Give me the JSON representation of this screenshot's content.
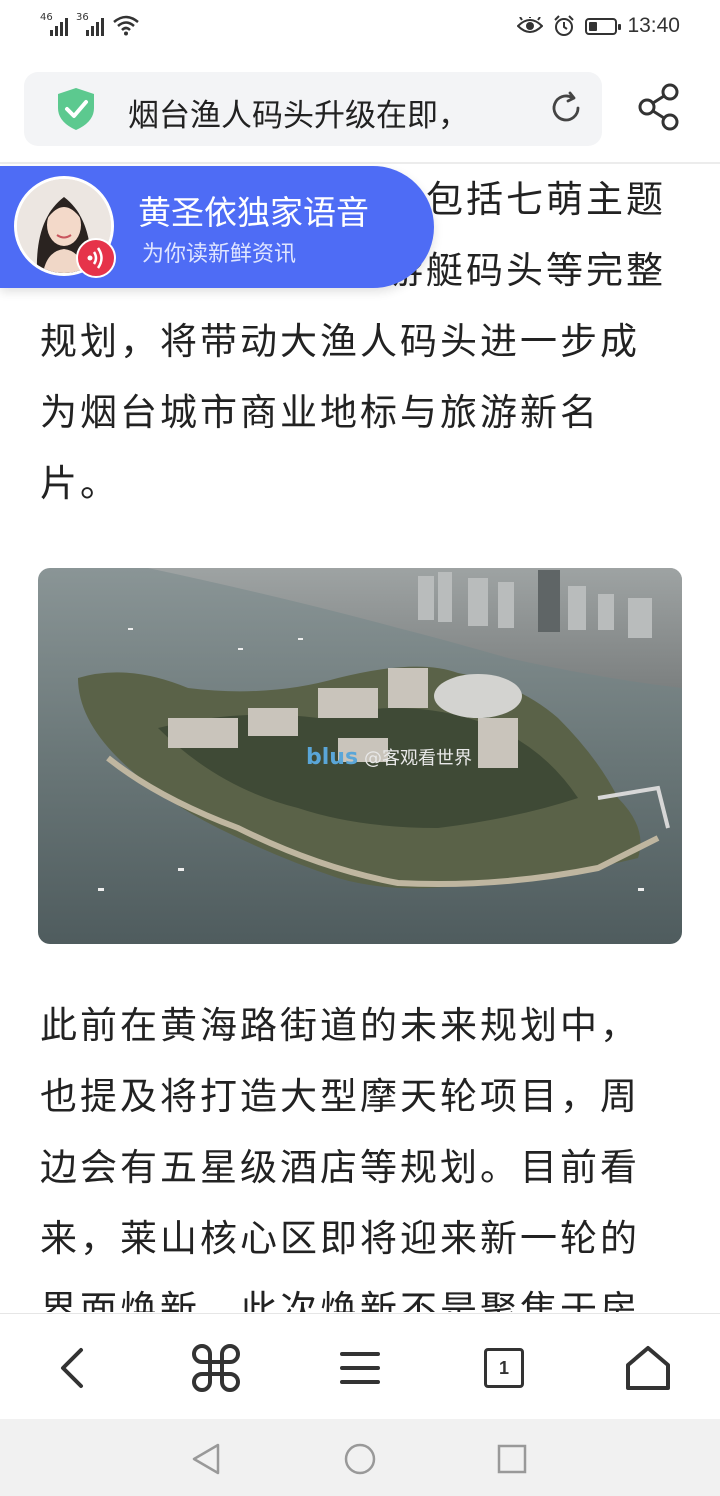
{
  "status_bar": {
    "network_1": "46",
    "network_2": "36",
    "time": "13:40",
    "icons": [
      "signal-icon",
      "signal-icon",
      "wifi-icon",
      "eye-icon",
      "alarm-icon",
      "battery-icon"
    ],
    "battery_level": 0.35
  },
  "address_bar": {
    "security_icon": "shield-check-icon",
    "title": "烟台渔人码头升级在即，",
    "reload_icon": "reload-icon",
    "share_icon": "share-icon",
    "shield_color": "#5cc98f"
  },
  "voice_banner": {
    "title": "黄圣依独家语音",
    "subtitle": "为你读新鲜资讯",
    "background": "#4e6cf5",
    "badge_color": "#e6334a"
  },
  "article": {
    "paragraph_1_lines": [
      "包括七萌主题",
      "游艇码头等完整",
      "规划，将带动大渔人码头进一步成",
      "为烟台城市商业地标与旅游新名",
      "片。"
    ],
    "photo": {
      "watermark_brand": "blus",
      "watermark_text": "@客观看世界"
    },
    "paragraph_2_lines": [
      "此前在黄海路街道的未来规划中，",
      "也提及将打造大型摩天轮项目，周",
      "边会有五星级酒店等规划。目前看",
      "来，莱山核心区即将迎来新一轮的",
      "界面焕新，此次焕新不是聚焦于房"
    ]
  },
  "toolbar": {
    "tab_count": "1",
    "buttons": [
      "back-icon",
      "command-icon",
      "menu-icon",
      "tabs-icon",
      "home-icon"
    ]
  },
  "system_nav": {
    "buttons": [
      "nav-back-icon",
      "nav-home-icon",
      "nav-recents-icon"
    ]
  }
}
